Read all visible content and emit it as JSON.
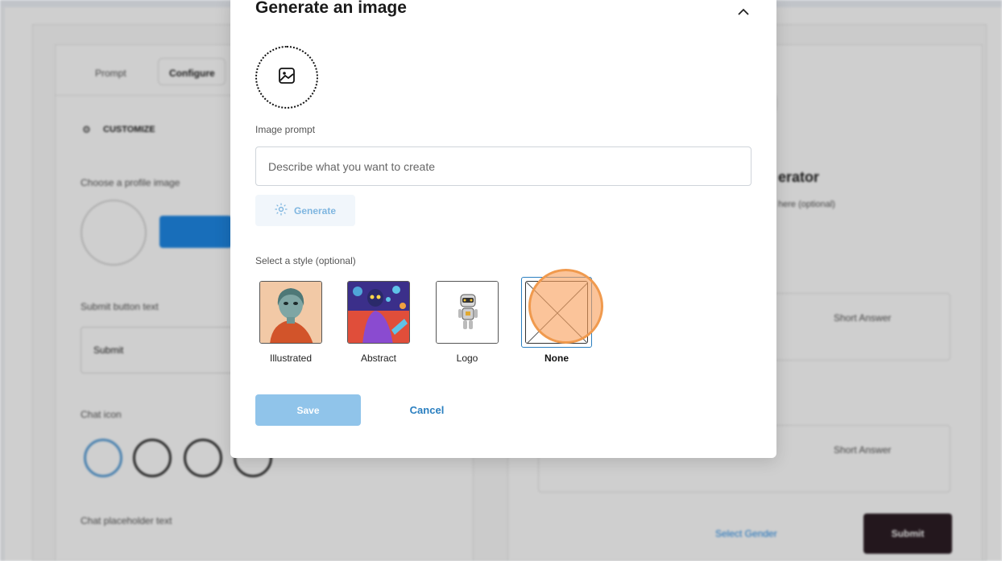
{
  "background": {
    "tabs": [
      "Prompt",
      "Configure"
    ],
    "section_title": "CUSTOMIZE",
    "profile_label": "Choose a profile image",
    "submit_label": "Submit button text",
    "submit_value": "Submit",
    "chat_icon_label": "Chat icon",
    "placeholder_label": "Chat placeholder text",
    "right_title": "erator",
    "right_sub": "here (optional)",
    "field_type": "Short Answer",
    "select_gender": "Select Gender",
    "submit_button": "Submit"
  },
  "modal": {
    "title": "Generate an image",
    "image_prompt_label": "Image prompt",
    "prompt_placeholder": "Describe what you want to create",
    "generate_label": "Generate",
    "style_label": "Select a style (optional)",
    "styles": [
      {
        "label": "Illustrated"
      },
      {
        "label": "Abstract"
      },
      {
        "label": "Logo"
      },
      {
        "label": "None",
        "selected": true
      }
    ],
    "save_label": "Save",
    "cancel_label": "Cancel"
  },
  "colors": {
    "accent": "#2a7fc0",
    "save_button": "#90c4ea",
    "click_marker": "#f09a4e"
  }
}
